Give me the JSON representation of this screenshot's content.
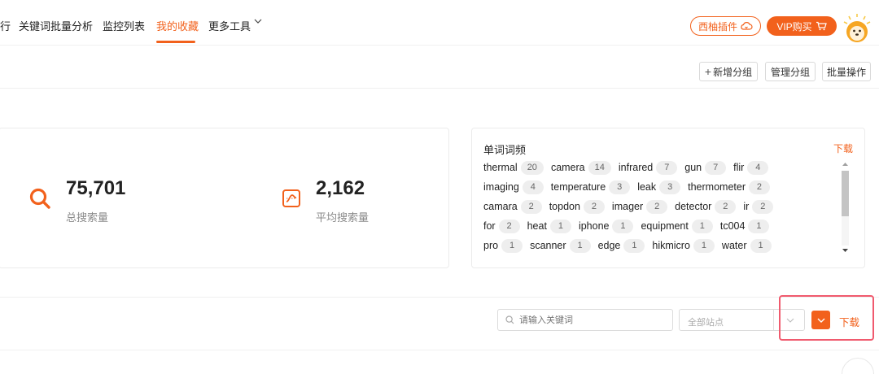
{
  "nav": {
    "items": [
      {
        "label": "行"
      },
      {
        "label": "关键词批量分析"
      },
      {
        "label": "监控列表"
      },
      {
        "label": "我的收藏"
      },
      {
        "label": "更多工具"
      }
    ],
    "active_index": 3,
    "plugin_label": "西柚插件",
    "vip_label": "VIP购买"
  },
  "toolbar": {
    "add_group": "新增分组",
    "manage_group": "管理分组",
    "batch_ops": "批量操作"
  },
  "stats": {
    "total": {
      "value": "75,701",
      "label": "总搜索量"
    },
    "average": {
      "value": "2,162",
      "label": "平均搜索量"
    }
  },
  "word_freq": {
    "title": "单词词频",
    "download": "下载",
    "rows": [
      [
        {
          "w": "thermal",
          "c": "20"
        },
        {
          "w": "camera",
          "c": "14"
        },
        {
          "w": "infrared",
          "c": "7"
        },
        {
          "w": "gun",
          "c": "7"
        },
        {
          "w": "flir",
          "c": "4"
        }
      ],
      [
        {
          "w": "imaging",
          "c": "4"
        },
        {
          "w": "temperature",
          "c": "3"
        },
        {
          "w": "leak",
          "c": "3"
        },
        {
          "w": "thermometer",
          "c": "2"
        }
      ],
      [
        {
          "w": "camara",
          "c": "2"
        },
        {
          "w": "topdon",
          "c": "2"
        },
        {
          "w": "imager",
          "c": "2"
        },
        {
          "w": "detector",
          "c": "2"
        },
        {
          "w": "ir",
          "c": "2"
        }
      ],
      [
        {
          "w": "for",
          "c": "2"
        },
        {
          "w": "heat",
          "c": "1"
        },
        {
          "w": "iphone",
          "c": "1"
        },
        {
          "w": "equipment",
          "c": "1"
        },
        {
          "w": "tc004",
          "c": "1"
        }
      ],
      [
        {
          "w": "pro",
          "c": "1"
        },
        {
          "w": "scanner",
          "c": "1"
        },
        {
          "w": "edge",
          "c": "1"
        },
        {
          "w": "hikmicro",
          "c": "1"
        },
        {
          "w": "water",
          "c": "1"
        }
      ]
    ]
  },
  "filters": {
    "search_placeholder": "请输入关键词",
    "site_placeholder": "全部站点",
    "download": "下载"
  },
  "colors": {
    "accent": "#f2611c",
    "highlight_box": "#f05a6e"
  }
}
